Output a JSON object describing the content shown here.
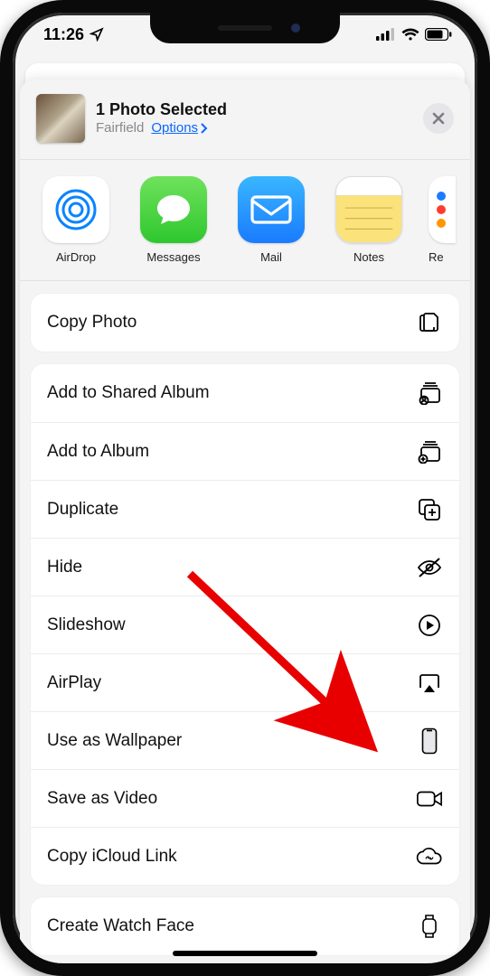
{
  "status": {
    "time": "11:26"
  },
  "header": {
    "title": "1 Photo Selected",
    "location": "Fairfield",
    "options": "Options"
  },
  "apps": [
    {
      "key": "airdrop",
      "label": "AirDrop"
    },
    {
      "key": "messages",
      "label": "Messages"
    },
    {
      "key": "mail",
      "label": "Mail"
    },
    {
      "key": "notes",
      "label": "Notes"
    },
    {
      "key": "re",
      "label": "Re"
    }
  ],
  "group1": [
    {
      "key": "copy_photo",
      "label": "Copy Photo",
      "icon": "copy-photo-icon"
    }
  ],
  "group2": [
    {
      "key": "shared_album",
      "label": "Add to Shared Album",
      "icon": "shared-album-icon"
    },
    {
      "key": "add_album",
      "label": "Add to Album",
      "icon": "add-album-icon"
    },
    {
      "key": "duplicate",
      "label": "Duplicate",
      "icon": "duplicate-icon"
    },
    {
      "key": "hide",
      "label": "Hide",
      "icon": "hide-icon"
    },
    {
      "key": "slideshow",
      "label": "Slideshow",
      "icon": "slideshow-icon"
    },
    {
      "key": "airplay",
      "label": "AirPlay",
      "icon": "airplay-icon"
    },
    {
      "key": "wallpaper",
      "label": "Use as Wallpaper",
      "icon": "wallpaper-icon"
    },
    {
      "key": "save_video",
      "label": "Save as Video",
      "icon": "video-icon"
    },
    {
      "key": "icloud_link",
      "label": "Copy iCloud Link",
      "icon": "icloud-link-icon"
    }
  ],
  "group3": [
    {
      "key": "watch_face",
      "label": "Create Watch Face",
      "icon": "watch-icon"
    }
  ]
}
